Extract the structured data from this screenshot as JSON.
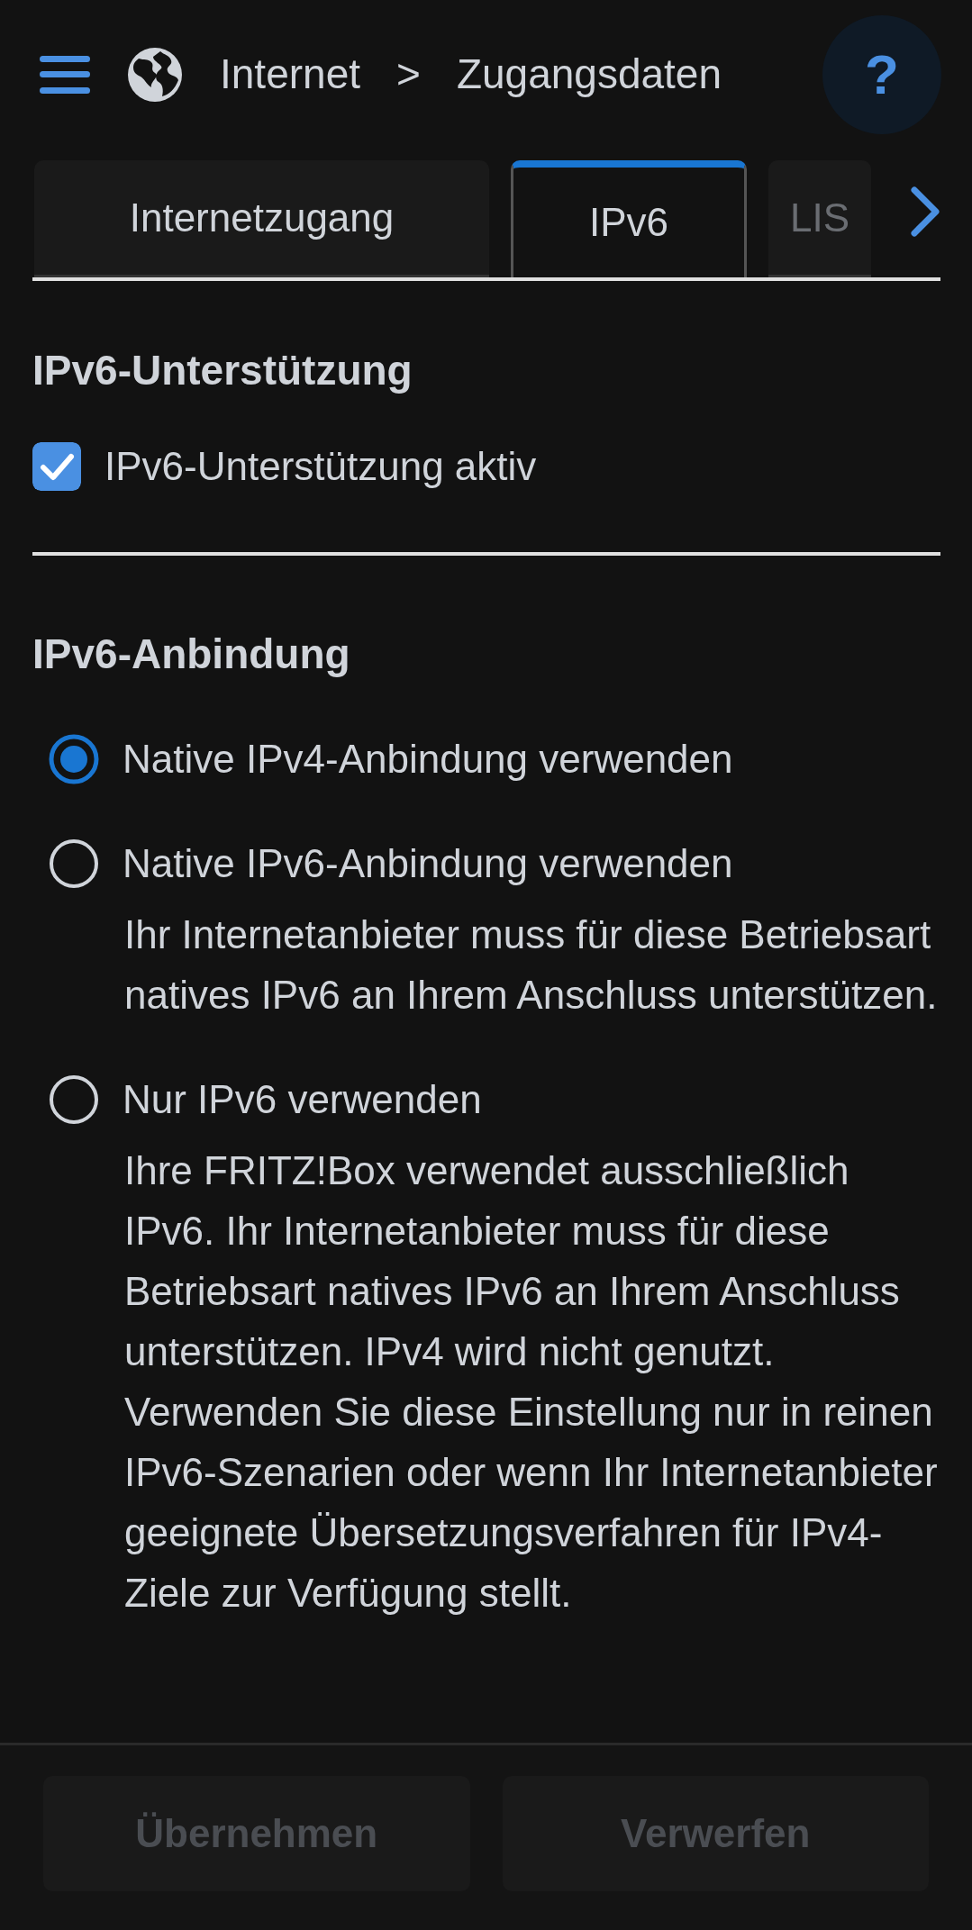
{
  "header": {
    "breadcrumb": [
      "Internet",
      "Zugangsdaten"
    ],
    "separator": ">",
    "help": "?"
  },
  "tabs": [
    {
      "label": "Internetzugang",
      "selected": false,
      "disabled": false
    },
    {
      "label": "IPv6",
      "selected": true,
      "disabled": false
    },
    {
      "label": "LIS",
      "selected": false,
      "disabled": true
    }
  ],
  "sections": [
    {
      "title": "IPv6-Unterstützung",
      "options": [
        {
          "kind": "checkbox",
          "label": "IPv6-Unterstützung aktiv",
          "checked": true
        }
      ]
    },
    {
      "title": "IPv6-Anbindung",
      "options": [
        {
          "kind": "radio",
          "label": "Native IPv4-Anbindung verwenden",
          "selected": true
        },
        {
          "kind": "radio",
          "label": "Native IPv6-Anbindung verwenden",
          "selected": false,
          "description": "Ihr Internetanbieter muss für diese Betriebsart natives IPv6 an Ihrem Anschluss unterstützen."
        },
        {
          "kind": "radio",
          "label": "Nur IPv6 verwenden",
          "selected": false,
          "description": "Ihre FRITZ!Box verwendet ausschließlich IPv6. Ihr Internetanbieter muss für diese Betriebsart natives IPv6 an Ihrem Anschluss unterstützen. IPv4 wird nicht genutzt. Verwenden Sie diese Einstellung nur in reinen IPv6-Szenarien oder wenn Ihr Internetanbieter geeignete Übersetzungsverfahren für IPv4-Ziele zur Verfügung stellt."
        }
      ]
    }
  ],
  "buttons": [
    {
      "label": "Übernehmen",
      "disabled": true
    },
    {
      "label": "Verwerfen",
      "disabled": true
    }
  ]
}
